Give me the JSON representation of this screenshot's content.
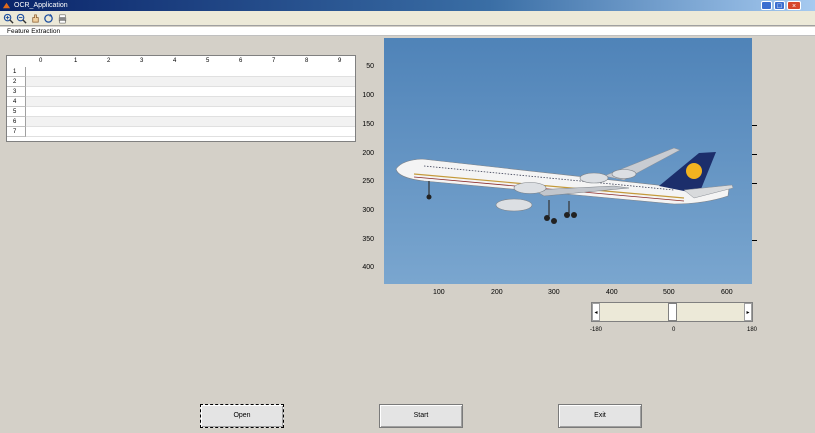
{
  "window": {
    "title": "OCR_Application"
  },
  "toolbar": {
    "icons": [
      "zoom-in-icon",
      "zoom-out-icon",
      "pan-icon",
      "rotate-icon",
      "print-icon"
    ]
  },
  "strip": {
    "label": "Feature Extraction"
  },
  "table": {
    "column_headers": [
      "0",
      "1",
      "2",
      "3",
      "4",
      "5",
      "6",
      "7",
      "8",
      "9"
    ],
    "row_headers": [
      "1",
      "2",
      "3",
      "4",
      "5",
      "6",
      "7"
    ]
  },
  "axes": {
    "y_ticks": [
      "50",
      "100",
      "150",
      "200",
      "250",
      "300",
      "350",
      "400"
    ],
    "x_ticks": [
      "100",
      "200",
      "300",
      "400",
      "500",
      "600"
    ]
  },
  "slider": {
    "min_label": "-180",
    "mid_label": "0",
    "max_label": "180",
    "value": 0
  },
  "buttons": {
    "open": "Open",
    "start": "Start",
    "exit": "Exit"
  },
  "colors": {
    "sky": "#5d8fc0",
    "titlebar": "#0a246a",
    "tail_yellow": "#f2b320"
  }
}
